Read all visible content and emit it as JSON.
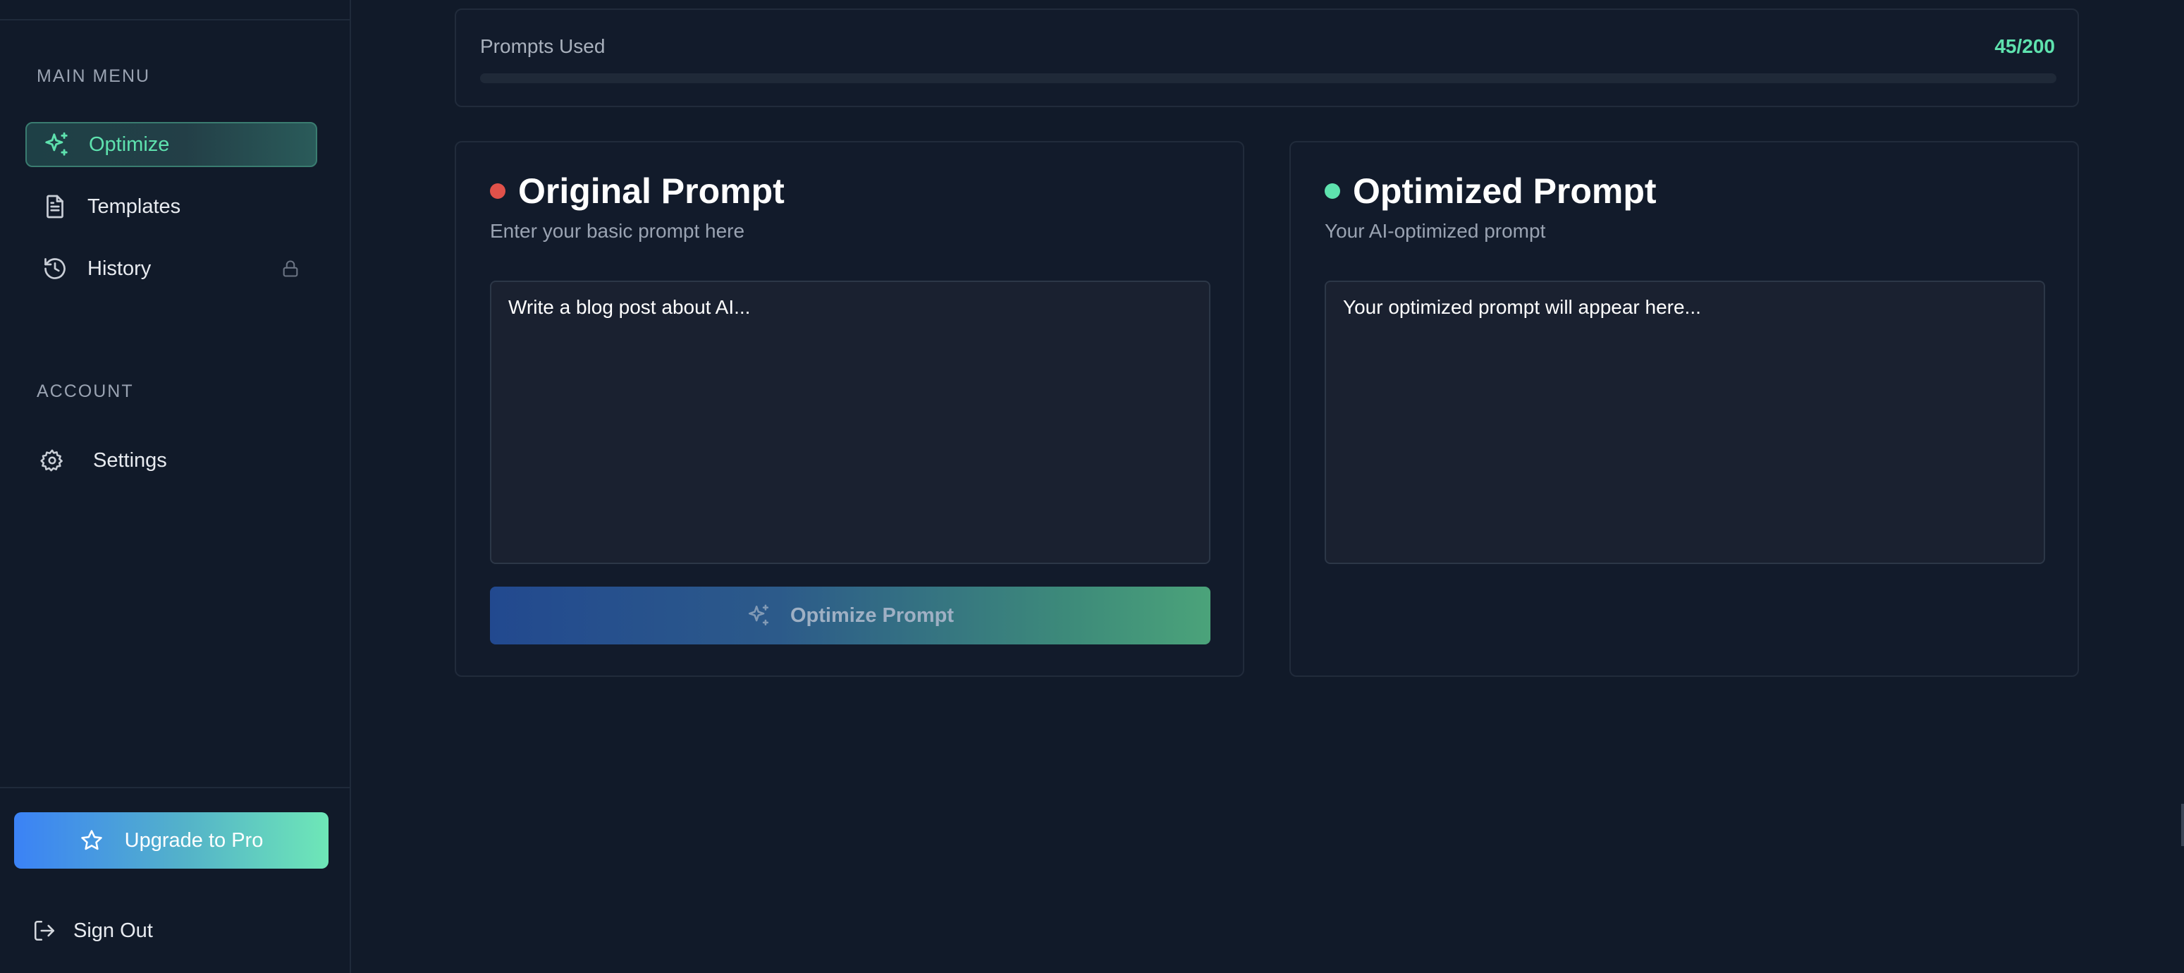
{
  "colors": {
    "accent_green": "#5ee2ae",
    "dot_red": "#e0514a",
    "dot_green": "#5ee2ae",
    "upgrade_gradient_start": "#3b82f6",
    "upgrade_gradient_end": "#6ee7b7"
  },
  "sidebar": {
    "main_menu_title": "MAIN MENU",
    "items": [
      {
        "label": "Optimize",
        "icon": "sparkles-icon",
        "active": true
      },
      {
        "label": "Templates",
        "icon": "document-icon",
        "active": false
      },
      {
        "label": "History",
        "icon": "history-icon",
        "active": false,
        "locked": true
      }
    ],
    "account_title": "ACCOUNT",
    "account_items": [
      {
        "label": "Settings",
        "icon": "gear-icon"
      }
    ],
    "upgrade_label": "Upgrade to Pro",
    "signout_label": "Sign Out"
  },
  "usage": {
    "label": "Prompts Used",
    "count_text": "45/200",
    "used": 45,
    "total": 200,
    "fraction": 0.225
  },
  "original": {
    "title": "Original Prompt",
    "subtitle": "Enter your basic prompt here",
    "placeholder": "Write a blog post about AI...",
    "value": "",
    "button_label": "Optimize Prompt"
  },
  "optimized": {
    "title": "Optimized Prompt",
    "subtitle": "Your AI-optimized prompt",
    "placeholder": "Your optimized prompt will appear here...",
    "value": ""
  }
}
